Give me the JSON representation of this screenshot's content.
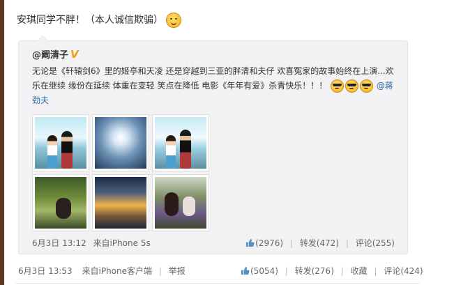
{
  "post": {
    "text": "安琪同学不胖！（本人诚信欺骗）"
  },
  "repost": {
    "author": "@阚清子",
    "vip_badge": "V",
    "text_line1_a": "无论是《轩辕剑6》里的姬亭和天凌 还是穿越到三亚的胖清和夫仔 欢喜冤家的故事始终在上演...",
    "text_line1_b": "欢",
    "text_line2": "乐在继续 缘份在延续 体重在变轻 笑点在降低 电影《年年有爱》杀青快乐！！！",
    "mention_part1": "@蒋",
    "mention_part2": "劲夫",
    "date": "6月3日 13:12",
    "source": "来自iPhone 5s",
    "like_count": "(2976)",
    "repost_label": "转发(472)",
    "comment_label": "评论(255)"
  },
  "footer": {
    "date": "6月3日 13:53",
    "source": "来自iPhone客户端",
    "report": "举报",
    "like_count": "(5054)",
    "repost_label": "转发(276)",
    "favorite_label": "收藏",
    "comment_label": "评论(424)"
  },
  "icons": {
    "emoji": "grimace-emoji-icon",
    "cool_emoji": "sunglasses-emoji-icon",
    "like": "thumbs-up-icon",
    "vip": "vip-badge-icon"
  },
  "colors": {
    "link": "#2b6aa3",
    "repost_bg": "#f2f2f5",
    "vip": "#f0a000"
  }
}
